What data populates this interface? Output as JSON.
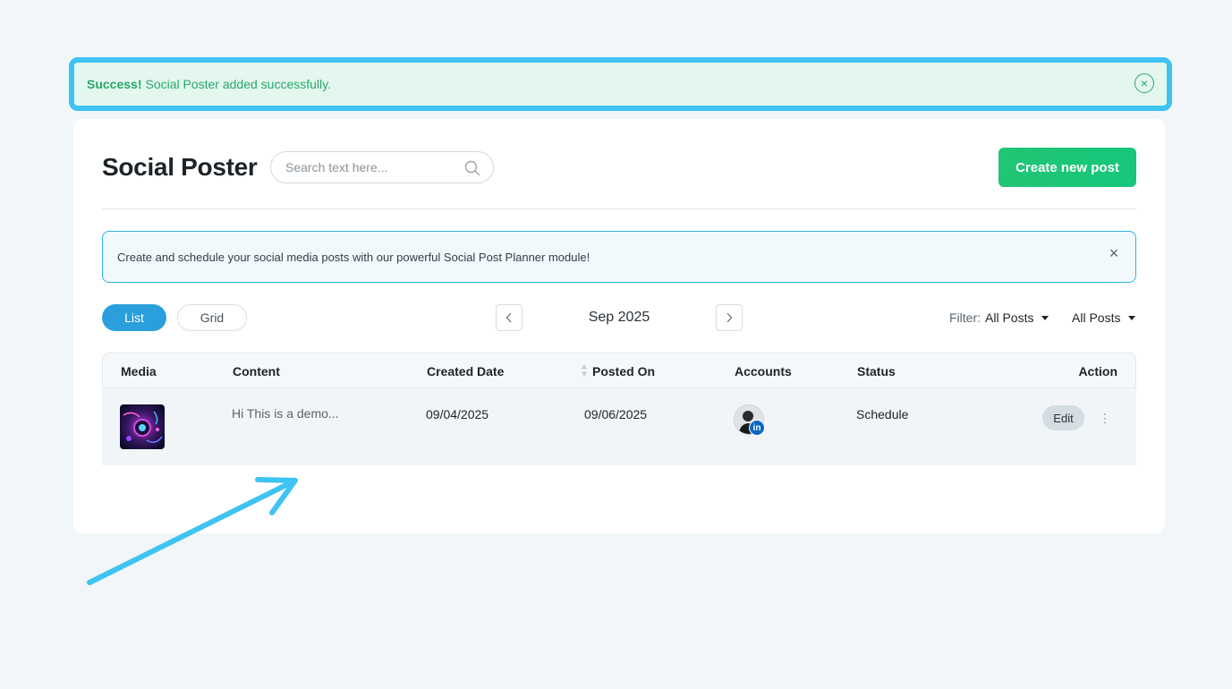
{
  "alert": {
    "strong": "Success!",
    "message": "Social Poster added successfully.",
    "close_icon": "circle-x-icon",
    "color": "#28a868"
  },
  "page": {
    "title": "Social Poster",
    "create_button": "Create new post"
  },
  "search": {
    "placeholder": "Search text here...",
    "value": ""
  },
  "info_banner": {
    "text": "Create and schedule your social media posts with our powerful Social Post Planner module!",
    "close_icon": "x-icon"
  },
  "view_toggle": {
    "list_label": "List",
    "grid_label": "Grid",
    "active": "List"
  },
  "period": {
    "label": "Sep 2025"
  },
  "filters": {
    "filter_label": "Filter:",
    "filter_value": "All Posts",
    "second_value": "All Posts"
  },
  "table": {
    "columns": {
      "media": "Media",
      "content": "Content",
      "created": "Created Date",
      "posted": "Posted On",
      "accounts": "Accounts",
      "status": "Status",
      "action": "Action"
    },
    "rows": [
      {
        "content": "Hi This is a demo...",
        "created": "09/04/2025",
        "posted": "09/06/2025",
        "account_network": "in",
        "status": "Schedule",
        "edit_label": "Edit"
      }
    ]
  },
  "colors": {
    "accent": "#2a9fdc",
    "create_button": "#1ec676",
    "annotation": "#3ec3f2"
  }
}
